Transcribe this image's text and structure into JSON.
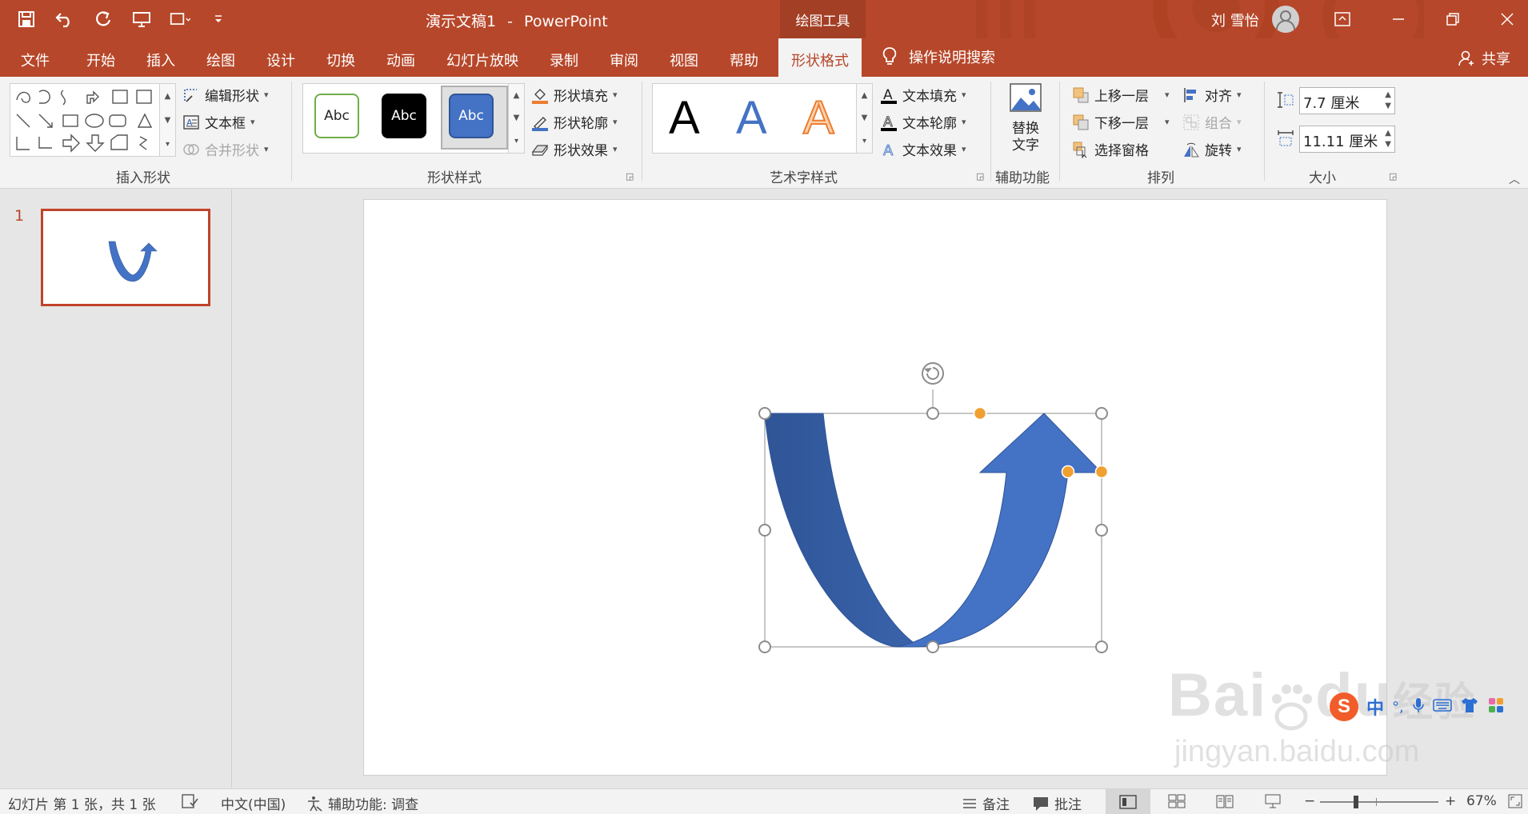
{
  "window": {
    "doc_title": "演示文稿1",
    "title_sep": "-",
    "app_name": "PowerPoint",
    "context_tool": "绘图工具",
    "user_name": "刘 雪怡"
  },
  "tabs": [
    {
      "label": "文件"
    },
    {
      "label": "开始"
    },
    {
      "label": "插入"
    },
    {
      "label": "绘图"
    },
    {
      "label": "设计"
    },
    {
      "label": "切换"
    },
    {
      "label": "动画"
    },
    {
      "label": "幻灯片放映"
    },
    {
      "label": "录制"
    },
    {
      "label": "审阅"
    },
    {
      "label": "视图"
    },
    {
      "label": "帮助"
    },
    {
      "label": "形状格式",
      "active": true
    }
  ],
  "search": {
    "label": "操作说明搜索"
  },
  "share": {
    "label": "共享"
  },
  "ribbon": {
    "insert_shapes": {
      "edit_shape": "编辑形状",
      "text_box": "文本框",
      "merge_shapes": "合并形状",
      "group_label": "插入形状"
    },
    "shape_styles": {
      "presets": [
        "Abc",
        "Abc",
        "Abc"
      ],
      "fill": "形状填充",
      "outline": "形状轮廓",
      "effects": "形状效果",
      "group_label": "形状样式"
    },
    "wordart": {
      "presets": [
        "A",
        "A",
        "A"
      ],
      "text_fill": "文本填充",
      "text_outline": "文本轮廓",
      "text_effects": "文本效果",
      "group_label": "艺术字样式"
    },
    "accessibility": {
      "alt_text_line1": "替换",
      "alt_text_line2": "文字",
      "group_label": "辅助功能"
    },
    "arrange": {
      "bring_forward": "上移一层",
      "send_backward": "下移一层",
      "selection_pane": "选择窗格",
      "align": "对齐",
      "group": "组合",
      "rotate": "旋转",
      "group_label": "排列"
    },
    "size": {
      "height": "7.7 厘米",
      "width": "11.11 厘米",
      "group_label": "大小"
    }
  },
  "thumbnails": [
    {
      "number": "1"
    }
  ],
  "colors": {
    "accent": "#b7472a",
    "shape_fill": "#4472c4",
    "shape_fill_dark": "#2f5597",
    "handle_adjust": "#f0a030"
  },
  "status": {
    "slide_info": "幻灯片 第 1 张，共 1 张",
    "language": "中文(中国)",
    "accessibility": "辅助功能: 调查",
    "notes": "备注",
    "comments": "批注",
    "zoom": "67%"
  },
  "watermark": {
    "brand": "Bai",
    "brand_mid": "du",
    "suffix": "经验",
    "url": "jingyan.baidu.com"
  },
  "ime": {
    "mode": "中"
  }
}
